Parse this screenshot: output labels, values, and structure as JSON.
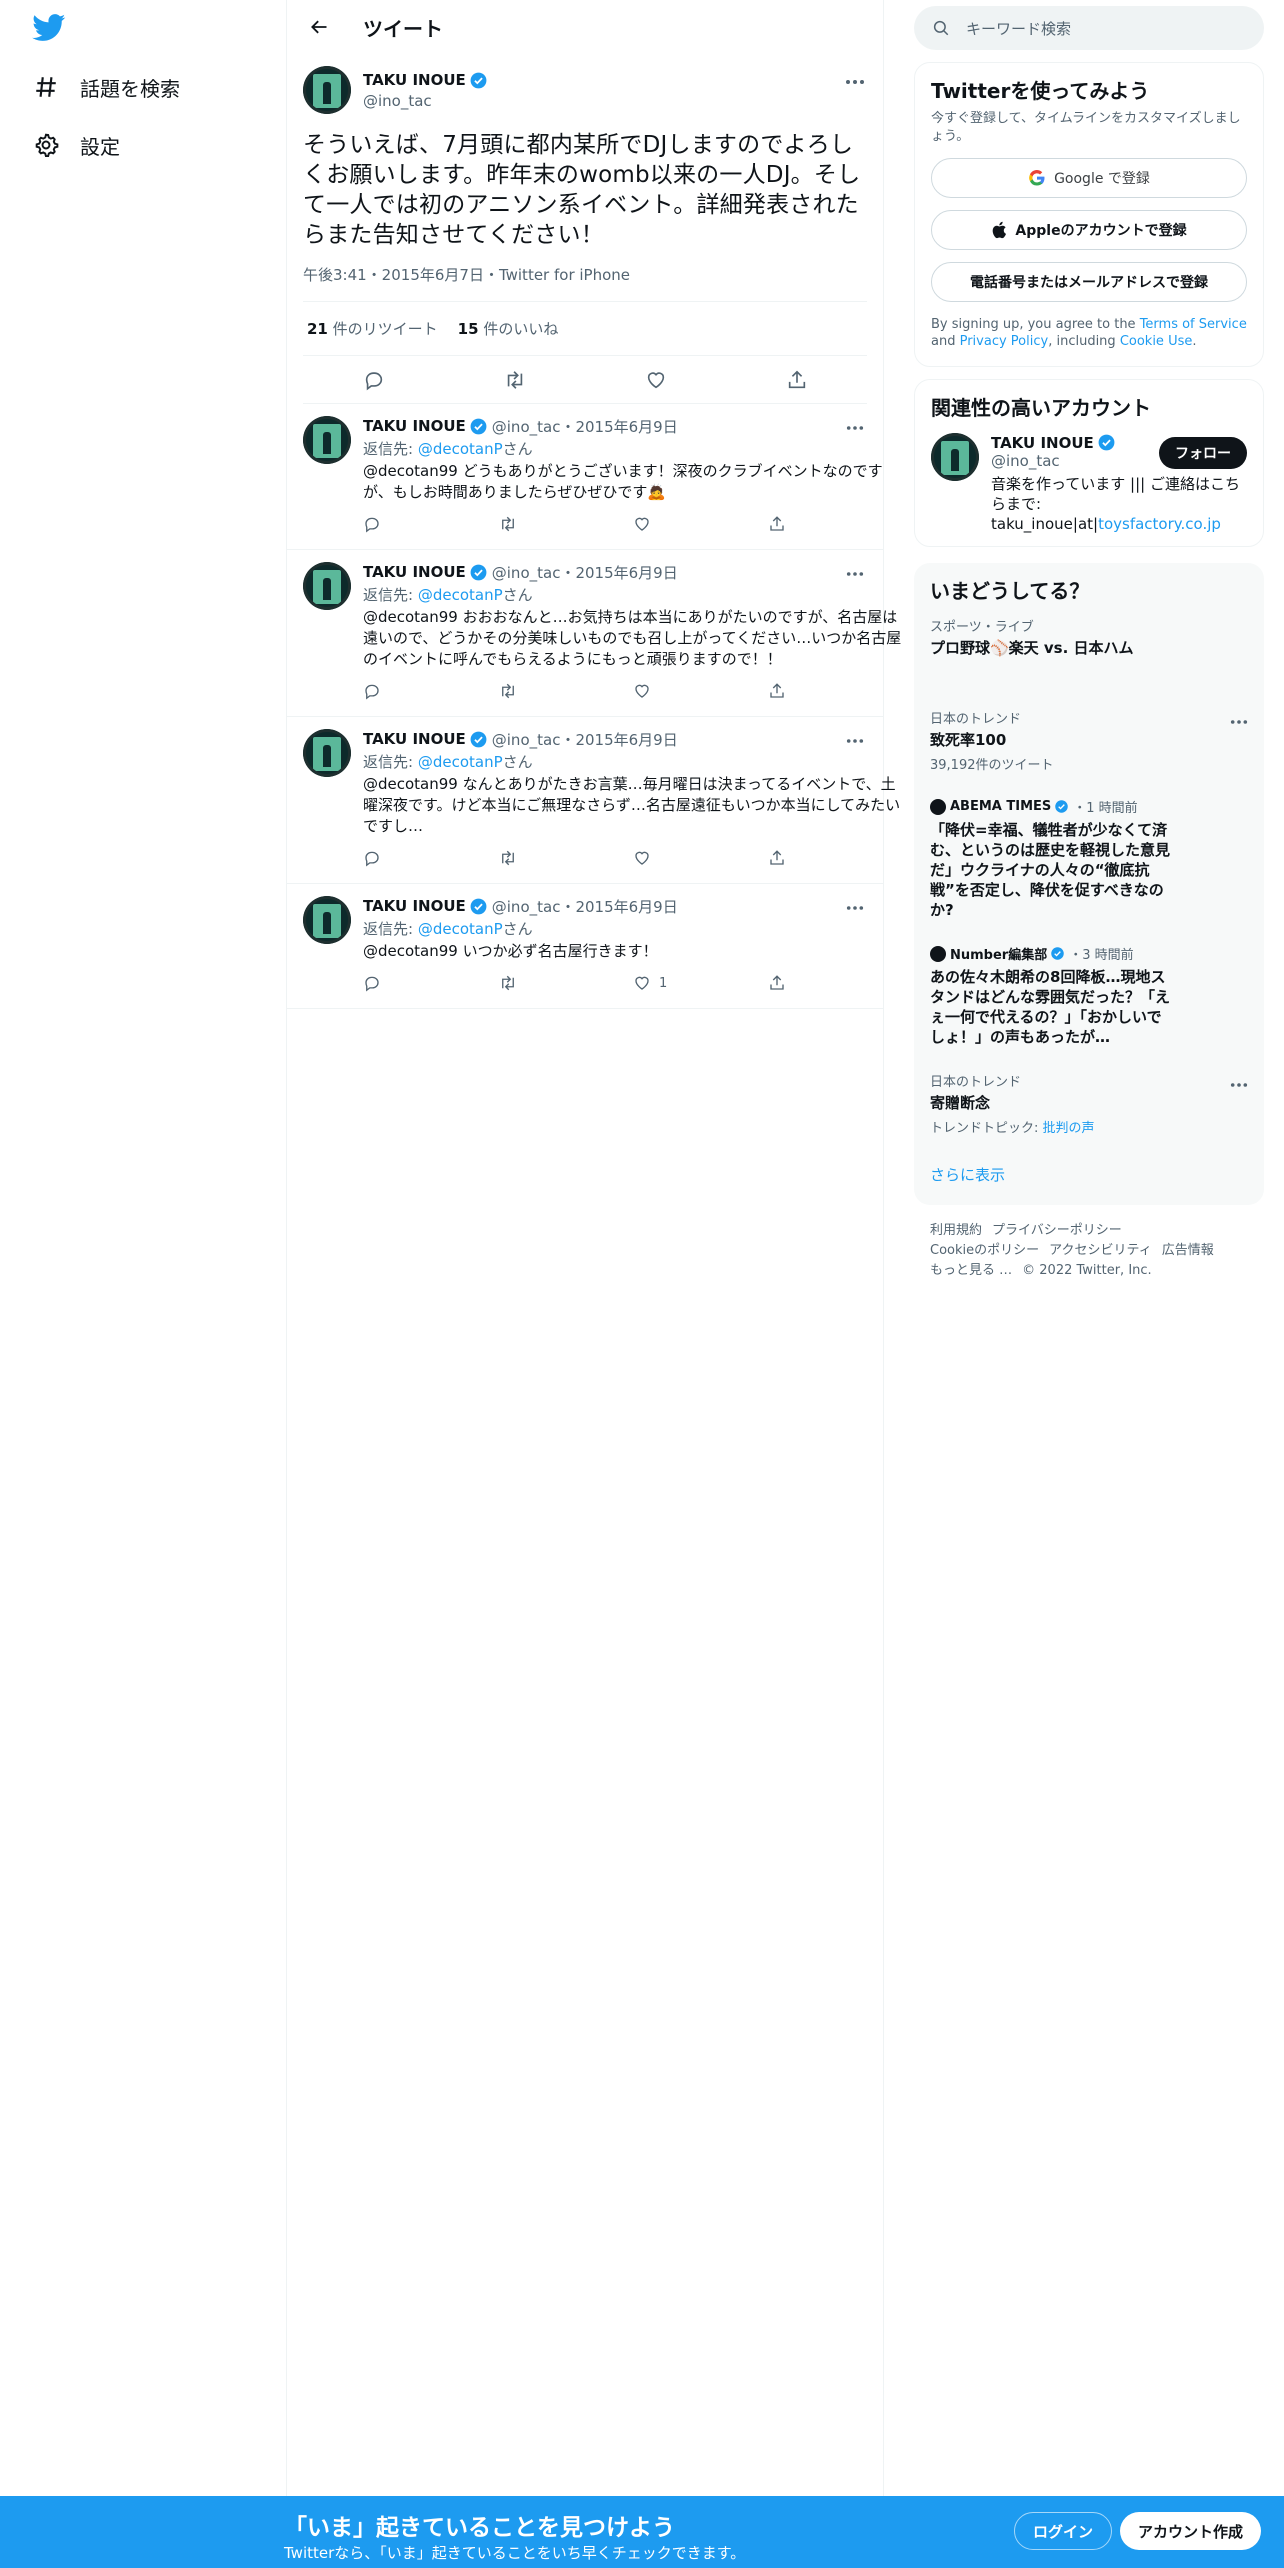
{
  "nav": {
    "explore_label": "話題を検索",
    "settings_label": "設定"
  },
  "header": {
    "title": "ツイート"
  },
  "main_tweet": {
    "name": "TAKU INOUE",
    "handle": "@ino_tac",
    "text": "そういえば、7月頭に都内某所でDJしますのでよろしくお願いします。昨年末のwomb以来の一人DJ。そして一人では初のアニソン系イベント。詳細発表されたらまた告知させてください！",
    "meta": "午後3:41・2015年6月7日・Twitter for iPhone",
    "retweets_count": "21",
    "retweets_label": "件のリツイート",
    "likes_count": "15",
    "likes_label": "件のいいね"
  },
  "replies": [
    {
      "name": "TAKU INOUE",
      "sub": "@ino_tac・2015年6月9日",
      "replyto_prefix": "返信先: ",
      "replyto_handle": "@decotanP",
      "replyto_suffix": "さん",
      "text": "@decotan99 どうもありがとうございます！深夜のクラブイベントなのですが、もしお時間ありましたらぜひぜひです🙇",
      "like_count": ""
    },
    {
      "name": "TAKU INOUE",
      "sub": "@ino_tac・2015年6月9日",
      "replyto_prefix": "返信先: ",
      "replyto_handle": "@decotanP",
      "replyto_suffix": "さん",
      "text": "@decotan99 おおおなんと…お気持ちは本当にありがたいのですが、名古屋は遠いので、どうかその分美味しいものでも召し上がってください…いつか名古屋のイベントに呼んでもらえるようにもっと頑張りますので！！",
      "like_count": ""
    },
    {
      "name": "TAKU INOUE",
      "sub": "@ino_tac・2015年6月9日",
      "replyto_prefix": "返信先: ",
      "replyto_handle": "@decotanP",
      "replyto_suffix": "さん",
      "text": "@decotan99 なんとありがたきお言葉…毎月曜日は決まってるイベントで、土曜深夜です。けど本当にご無理なさらず…名古屋遠征もいつか本当にしてみたいですし…",
      "like_count": ""
    },
    {
      "name": "TAKU INOUE",
      "sub": "@ino_tac・2015年6月9日",
      "replyto_prefix": "返信先: ",
      "replyto_handle": "@decotanP",
      "replyto_suffix": "さん",
      "text": "@decotan99 いつか必ず名古屋行きます！",
      "like_count": "1"
    }
  ],
  "search": {
    "placeholder": "キーワード検索"
  },
  "signup_card": {
    "title": "Twitterを使ってみよう",
    "subtitle": "今すぐ登録して、タイムラインをカスタマイズしましょう。",
    "google_label": "Google で登録",
    "apple_label": "Appleのアカウントで登録",
    "phone_label": "電話番号またはメールアドレスで登録",
    "terms_prefix": "By signing up, you agree to the ",
    "terms_tos": "Terms of Service",
    "terms_and": " and ",
    "terms_privacy": "Privacy Policy",
    "terms_including": ", including ",
    "terms_cookie": "Cookie Use",
    "terms_end": "."
  },
  "related": {
    "title": "関連性の高いアカウント",
    "name": "TAKU INOUE",
    "handle": "@ino_tac",
    "follow_label": "フォロー",
    "bio_text": "音楽を作っています ||| ご連絡はこちらまで: taku_inoue|at|",
    "bio_link": "toysfactory.co.jp"
  },
  "trends": {
    "title": "いまどうしてる？",
    "items": [
      {
        "context": "スポーツ・ライブ",
        "name": "プロ野球⚾楽天 vs. 日本ハム",
        "sub": ""
      },
      {
        "context": "日本のトレンド",
        "name": "致死率100",
        "sub": "39,192件のツイート"
      }
    ],
    "news": [
      {
        "source": "ABEMA TIMES",
        "time": "・1 時間前",
        "title": "「降伏=幸福、犠牲者が少なくて済む、というのは歴史を軽視した意見だ」ウクライナの人々の“徹底抗戦”を否定し、降伏を促すべきなのか?"
      },
      {
        "source": "Number編集部",
        "time": "・3 時間前",
        "title": "あの佐々木朗希の8回降板…現地スタンドはどんな雰囲気だった？「えぇ一何で代えるの？」「おかしいでしょ！」の声もあったが…"
      }
    ],
    "last": {
      "context": "日本のトレンド",
      "name": "寄贈断念",
      "sub_prefix": "トレンドトピック: ",
      "sub_link": "批判の声"
    },
    "show_more": "さらに表示"
  },
  "footer": {
    "terms": "利用規約",
    "privacy": "プライバシーポリシー",
    "cookie": "Cookieのポリシー",
    "accessibility": "アクセシビリティ",
    "ads": "広告情報",
    "more": "もっと見る …",
    "copyright": "© 2022 Twitter, Inc."
  },
  "bottom_bar": {
    "title": "「いま」起きていることを見つけよう",
    "subtitle": "Twitterなら、「いま」起きていることをいち早くチェックできます。",
    "login_label": "ログイン",
    "signup_label": "アカウント作成"
  },
  "colors": {
    "accent": "#1d9bf0",
    "text": "#0f1419",
    "muted": "#536471"
  }
}
